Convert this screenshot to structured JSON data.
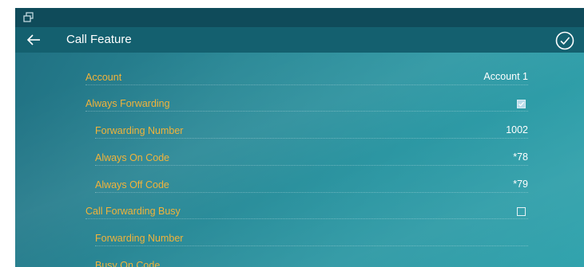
{
  "header": {
    "title": "Call Feature"
  },
  "icons": {
    "status": "window-restore-icon",
    "back": "back-arrow-icon",
    "confirm": "check-circle-icon"
  },
  "colors": {
    "status_bar": "#0f4b5a",
    "title_bar": "#14606f",
    "label": "#f2b33a",
    "value": "#ffffff"
  },
  "settings": {
    "account": {
      "label": "Account",
      "value": "Account 1"
    },
    "always_forwarding": {
      "label": "Always Forwarding",
      "checked": true
    },
    "af_forwarding_number": {
      "label": "Forwarding Number",
      "value": "1002"
    },
    "always_on_code": {
      "label": "Always On Code",
      "value": "*78"
    },
    "always_off_code": {
      "label": "Always Off Code",
      "value": "*79"
    },
    "call_forwarding_busy": {
      "label": "Call Forwarding Busy",
      "checked": false
    },
    "cfb_forwarding_number": {
      "label": "Forwarding Number",
      "value": ""
    },
    "busy_on_code": {
      "label": "Busy On Code",
      "value": ""
    }
  }
}
